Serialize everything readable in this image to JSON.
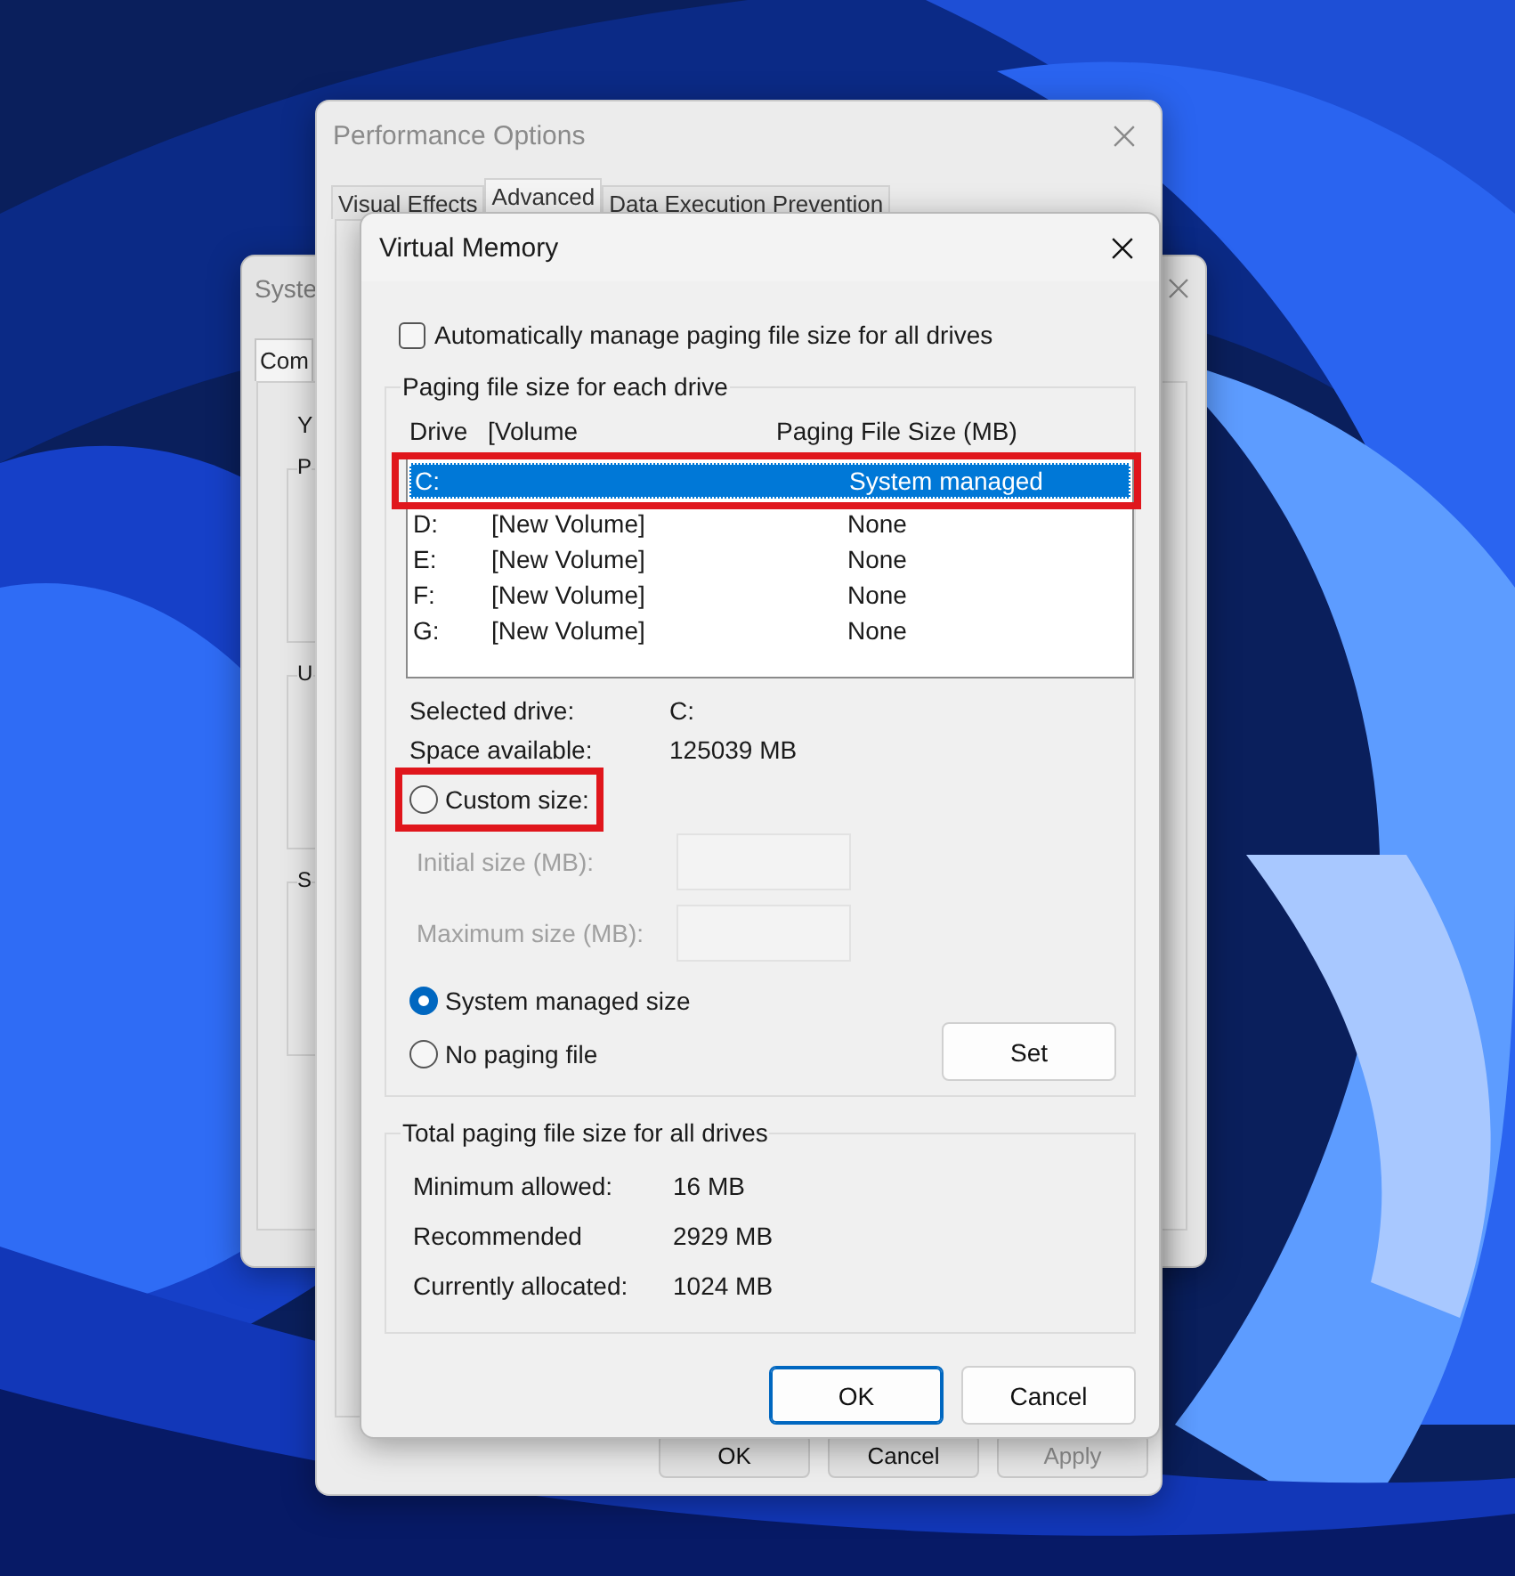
{
  "system_properties": {
    "title": "Syste",
    "tabs": [
      {
        "label": "Com",
        "selected": true
      }
    ],
    "intro": "Y",
    "groups": [
      {
        "label": "P"
      },
      {
        "label": "U"
      },
      {
        "label": "S"
      }
    ]
  },
  "performance_options": {
    "title": "Performance Options",
    "tabs": [
      {
        "label": "Visual Effects",
        "selected": false
      },
      {
        "label": "Advanced",
        "selected": true
      },
      {
        "label": "Data Execution Prevention",
        "selected": false
      }
    ],
    "buttons": [
      {
        "label": "OK",
        "disabled": false
      },
      {
        "label": "Cancel",
        "disabled": false
      },
      {
        "label": "Apply",
        "disabled": true
      }
    ]
  },
  "virtual_memory": {
    "title": "Virtual Memory",
    "auto_manage": {
      "label": "Automatically manage paging file size for all drives",
      "checked": false
    },
    "drives_group": {
      "label": "Paging file size for each drive",
      "columns": [
        "Drive",
        "[Volume",
        "Paging File Size (MB)"
      ],
      "rows": [
        {
          "drive": "C:",
          "size": "System managed",
          "selected": true,
          "highlighted": true
        },
        {
          "drive": "D:",
          "volume": "[New Volume]",
          "size": "None",
          "selected": false,
          "highlighted": false
        },
        {
          "drive": "E:",
          "volume": "[New Volume]",
          "size": "None",
          "selected": false,
          "highlighted": false
        },
        {
          "drive": "F:",
          "volume": "[New Volume]",
          "size": "None",
          "selected": false,
          "highlighted": false
        },
        {
          "drive": "G:",
          "volume": "[New Volume]",
          "size": "None",
          "selected": false,
          "highlighted": false
        }
      ],
      "info": [
        {
          "label": "Selected drive:",
          "value": "C:"
        },
        {
          "label": "Space available:",
          "value": "125039 MB"
        }
      ],
      "radios": [
        {
          "label": "Custom size:",
          "selected": false,
          "highlighted": true
        },
        {
          "label": "System managed size",
          "selected": true,
          "highlighted": false
        },
        {
          "label": "No paging file",
          "selected": false,
          "highlighted": false
        }
      ],
      "fields": [
        {
          "label": "Initial size (MB):",
          "disabled": true
        },
        {
          "label": "Maximum size (MB):",
          "disabled": true
        }
      ],
      "set_button": "Set"
    },
    "total_group": {
      "label": "Total paging file size for all drives",
      "rows": [
        {
          "label": "Minimum allowed:",
          "value": "16 MB"
        },
        {
          "label": "Recommended",
          "value": "2929 MB"
        },
        {
          "label": "Currently allocated:",
          "value": "1024 MB"
        }
      ]
    },
    "buttons": [
      {
        "label": "OK",
        "default": true
      },
      {
        "label": "Cancel",
        "default": false
      }
    ]
  }
}
